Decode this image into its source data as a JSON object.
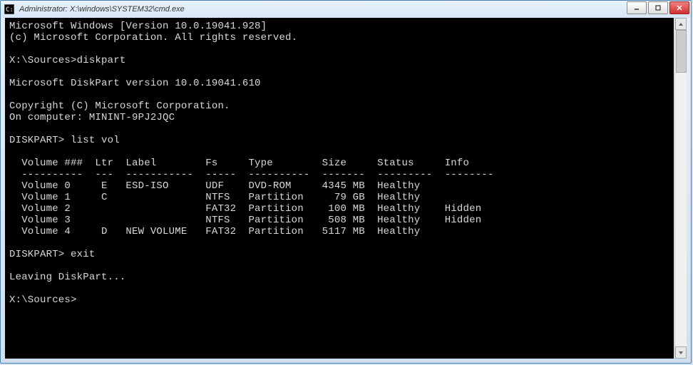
{
  "titlebar": {
    "title": "Administrator: X:\\windows\\SYSTEM32\\cmd.exe"
  },
  "terminal": {
    "line1": "Microsoft Windows [Version 10.0.19041.928]",
    "line2": "(c) Microsoft Corporation. All rights reserved.",
    "blank1": "",
    "line3": "X:\\Sources>diskpart",
    "blank2": "",
    "line4": "Microsoft DiskPart version 10.0.19041.610",
    "blank3": "",
    "line5": "Copyright (C) Microsoft Corporation.",
    "line6": "On computer: MININT-9PJ2JQC",
    "blank4": "",
    "line7": "DISKPART> list vol",
    "blank5": "",
    "header": "  Volume ###  Ltr  Label        Fs     Type        Size     Status     Info",
    "divider": "  ----------  ---  -----------  -----  ----------  -------  ---------  --------",
    "vol0": "  Volume 0     E   ESD-ISO      UDF    DVD-ROM     4345 MB  Healthy",
    "vol1": "  Volume 1     C                NTFS   Partition     79 GB  Healthy",
    "vol2": "  Volume 2                      FAT32  Partition    100 MB  Healthy    Hidden",
    "vol3": "  Volume 3                      NTFS   Partition    508 MB  Healthy    Hidden",
    "vol4": "  Volume 4     D   NEW VOLUME   FAT32  Partition   5117 MB  Healthy",
    "blank6": "",
    "line8": "DISKPART> exit",
    "blank7": "",
    "line9": "Leaving DiskPart...",
    "blank8": "",
    "line10": "X:\\Sources>"
  }
}
